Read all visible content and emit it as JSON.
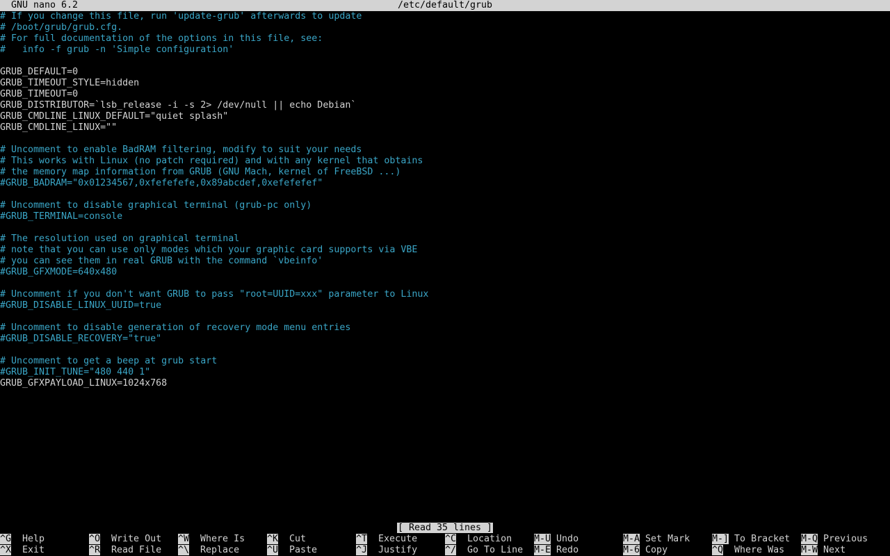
{
  "title": {
    "app": "GNU nano 6.2",
    "file": "/etc/default/grub"
  },
  "lines": [
    {
      "text": "# If you change this file, run 'update-grub' afterwards to update",
      "type": "comment"
    },
    {
      "text": "# /boot/grub/grub.cfg.",
      "type": "comment"
    },
    {
      "text": "# For full documentation of the options in this file, see:",
      "type": "comment"
    },
    {
      "text": "#   info -f grub -n 'Simple configuration'",
      "type": "comment"
    },
    {
      "text": "",
      "type": "code"
    },
    {
      "text": "GRUB_DEFAULT=0",
      "type": "code"
    },
    {
      "text": "GRUB_TIMEOUT_STYLE=hidden",
      "type": "code"
    },
    {
      "text": "GRUB_TIMEOUT=0",
      "type": "code"
    },
    {
      "text": "GRUB_DISTRIBUTOR=`lsb_release -i -s 2> /dev/null || echo Debian`",
      "type": "code"
    },
    {
      "text": "GRUB_CMDLINE_LINUX_DEFAULT=\"quiet splash\"",
      "type": "code"
    },
    {
      "text": "GRUB_CMDLINE_LINUX=\"\"",
      "type": "code"
    },
    {
      "text": "",
      "type": "code"
    },
    {
      "text": "# Uncomment to enable BadRAM filtering, modify to suit your needs",
      "type": "comment"
    },
    {
      "text": "# This works with Linux (no patch required) and with any kernel that obtains",
      "type": "comment"
    },
    {
      "text": "# the memory map information from GRUB (GNU Mach, kernel of FreeBSD ...)",
      "type": "comment"
    },
    {
      "text": "#GRUB_BADRAM=\"0x01234567,0xfefefefe,0x89abcdef,0xefefefef\"",
      "type": "comment"
    },
    {
      "text": "",
      "type": "code"
    },
    {
      "text": "# Uncomment to disable graphical terminal (grub-pc only)",
      "type": "comment"
    },
    {
      "text": "#GRUB_TERMINAL=console",
      "type": "comment"
    },
    {
      "text": "",
      "type": "code"
    },
    {
      "text": "# The resolution used on graphical terminal",
      "type": "comment"
    },
    {
      "text": "# note that you can use only modes which your graphic card supports via VBE",
      "type": "comment"
    },
    {
      "text": "# you can see them in real GRUB with the command `vbeinfo'",
      "type": "comment"
    },
    {
      "text": "#GRUB_GFXMODE=640x480",
      "type": "comment"
    },
    {
      "text": "",
      "type": "code"
    },
    {
      "text": "# Uncomment if you don't want GRUB to pass \"root=UUID=xxx\" parameter to Linux",
      "type": "comment"
    },
    {
      "text": "#GRUB_DISABLE_LINUX_UUID=true",
      "type": "comment"
    },
    {
      "text": "",
      "type": "code"
    },
    {
      "text": "# Uncomment to disable generation of recovery mode menu entries",
      "type": "comment"
    },
    {
      "text": "#GRUB_DISABLE_RECOVERY=\"true\"",
      "type": "comment"
    },
    {
      "text": "",
      "type": "code"
    },
    {
      "text": "# Uncomment to get a beep at grub start",
      "type": "comment"
    },
    {
      "text": "#GRUB_INIT_TUNE=\"480 440 1\"",
      "type": "comment"
    },
    {
      "text": "GRUB_GFXPAYLOAD_LINUX=1024x768",
      "type": "code"
    }
  ],
  "status": "[ Read 35 lines ]",
  "shortcuts": [
    {
      "key": "^G",
      "label": "Help"
    },
    {
      "key": "^X",
      "label": "Exit"
    },
    {
      "key": "^O",
      "label": "Write Out"
    },
    {
      "key": "^R",
      "label": "Read File"
    },
    {
      "key": "^W",
      "label": "Where Is"
    },
    {
      "key": "^\\",
      "label": "Replace"
    },
    {
      "key": "^K",
      "label": "Cut"
    },
    {
      "key": "^U",
      "label": "Paste"
    },
    {
      "key": "^T",
      "label": "Execute"
    },
    {
      "key": "^J",
      "label": "Justify"
    },
    {
      "key": "^C",
      "label": "Location"
    },
    {
      "key": "^/",
      "label": "Go To Line"
    },
    {
      "key": "M-U",
      "label": "Undo"
    },
    {
      "key": "M-E",
      "label": "Redo"
    },
    {
      "key": "M-A",
      "label": "Set Mark"
    },
    {
      "key": "M-6",
      "label": "Copy"
    },
    {
      "key": "M-]",
      "label": "To Bracket"
    },
    {
      "key": "^Q",
      "label": "Where Was"
    },
    {
      "key": "M-Q",
      "label": "Previous"
    },
    {
      "key": "M-W",
      "label": "Next"
    }
  ],
  "colors": {
    "background": "#000000",
    "text": "#d3d3d3",
    "comment": "#3aa6c7",
    "inverse_bg": "#d3d3d3"
  }
}
